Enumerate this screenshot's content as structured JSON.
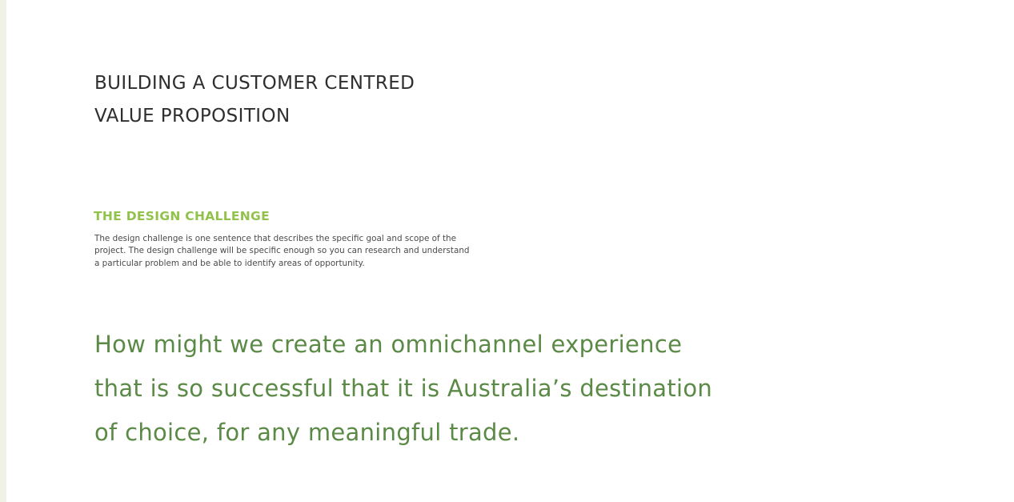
{
  "slide": {
    "title_lines": [
      "BUILDING A CUSTOMER CENTRED",
      "VALUE PROPOSITION"
    ],
    "section_heading": "THE DESIGN CHALLENGE",
    "description_lines": [
      "The design challenge is one sentence that describes the specific goal and scope of the",
      "project. The design challenge will be specific enough so you can research and understand",
      "a particular problem and be able to identify areas of opportunity."
    ],
    "question_lines": [
      "How might we create an omnichannel experience",
      "that is so successful that it is Australia’s destination",
      "of choice, for any meaningful trade."
    ]
  },
  "colors": {
    "background": "#ffffff",
    "title": "#2e2e2e",
    "heading_accent": "#92c24b",
    "body_text": "#4a4a4a",
    "question_text": "#5a8a46",
    "left_stripe": "#f1f2e6"
  }
}
